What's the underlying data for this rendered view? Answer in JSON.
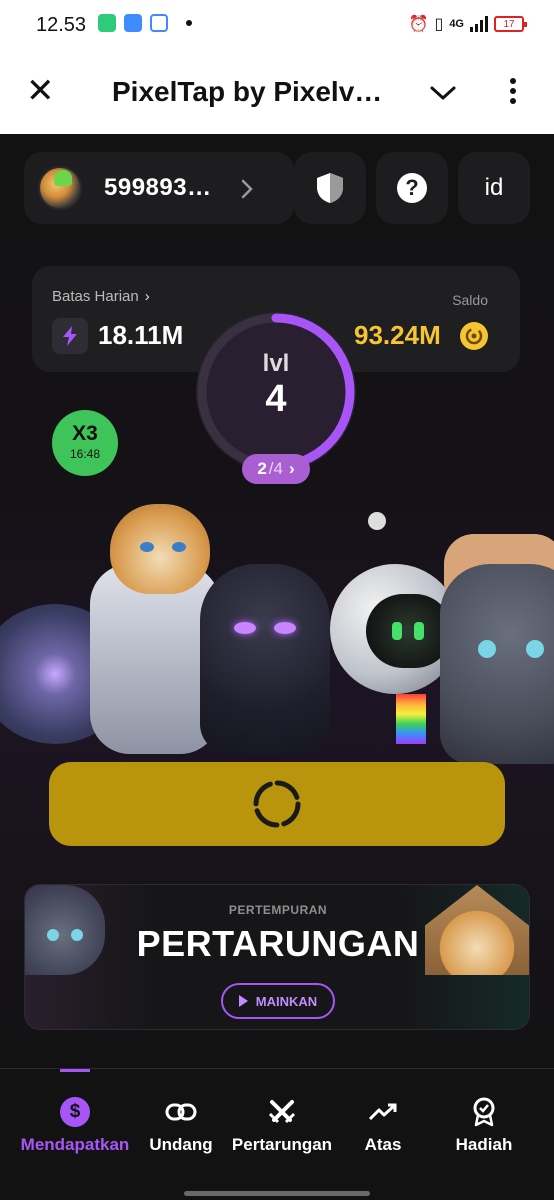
{
  "status_bar": {
    "time": "12.53",
    "network": "4G",
    "battery": "17"
  },
  "header": {
    "title": "PixelTap by Pixelv…"
  },
  "user": {
    "id": "599893…"
  },
  "top_buttons": {
    "language": "id"
  },
  "stats": {
    "daily_limit_label": "Batas Harian",
    "energy": "18.11M",
    "balance_label": "Saldo",
    "balance": "93.24M"
  },
  "level": {
    "label": "lvl",
    "value": "4",
    "progress_current": "2",
    "progress_total": "/4",
    "progress_fraction": 0.5
  },
  "multiplier": {
    "label": "X3",
    "timer": "16:48"
  },
  "battle_card": {
    "subtitle": "PERTEMPURAN",
    "title": "PERTARUNGAN",
    "play_label": "MAINKAN"
  },
  "nav": {
    "items": [
      {
        "label": "Mendapatkan",
        "icon": "dollar-icon"
      },
      {
        "label": "Undang",
        "icon": "link-icon"
      },
      {
        "label": "Pertarungan",
        "icon": "swords-icon"
      },
      {
        "label": "Atas",
        "icon": "trending-up-icon"
      },
      {
        "label": "Hadiah",
        "icon": "award-icon"
      }
    ]
  },
  "colors": {
    "accent": "#a855f7",
    "tap_button": "#b8950d",
    "balance": "#f6c531",
    "multiplier": "#3fc45a"
  }
}
